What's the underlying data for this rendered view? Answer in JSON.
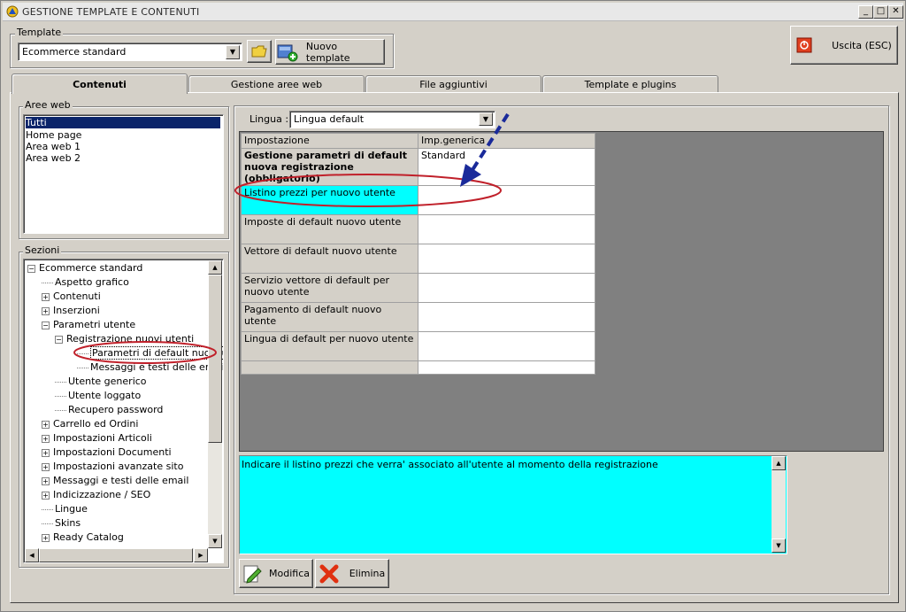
{
  "window": {
    "title": "GESTIONE TEMPLATE E CONTENUTI",
    "minimize": "_",
    "maximize": "□",
    "close": "✕"
  },
  "template": {
    "group_label": "Template",
    "selected": "Ecommerce standard",
    "new_button": "Nuovo template"
  },
  "exit_button": "Uscita (ESC)",
  "tabs": [
    {
      "label": "Contenuti",
      "active": true
    },
    {
      "label": "Gestione aree web",
      "active": false
    },
    {
      "label": "File aggiuntivi",
      "active": false
    },
    {
      "label": "Template e plugins",
      "active": false
    }
  ],
  "aree_web": {
    "label": "Aree web",
    "items": [
      "Tutti",
      "Home page",
      "Area web 1",
      "Area web 2"
    ],
    "selected_index": 0
  },
  "sezioni": {
    "label": "Sezioni",
    "tree": [
      {
        "label": "Ecommerce standard",
        "level": 0,
        "exp": "−"
      },
      {
        "label": "Aspetto grafico",
        "level": 1,
        "exp": ""
      },
      {
        "label": "Contenuti",
        "level": 1,
        "exp": "+"
      },
      {
        "label": "Inserzioni",
        "level": 1,
        "exp": "+"
      },
      {
        "label": "Parametri utente",
        "level": 1,
        "exp": "−"
      },
      {
        "label": "Registrazione nuovi utenti",
        "level": 2,
        "exp": "−"
      },
      {
        "label": "Parametri di default nuovi utent",
        "level": 3,
        "exp": "",
        "selected": true
      },
      {
        "label": "Messaggi e testi delle email",
        "level": 3,
        "exp": ""
      },
      {
        "label": "Utente generico",
        "level": 2,
        "exp": ""
      },
      {
        "label": "Utente loggato",
        "level": 2,
        "exp": ""
      },
      {
        "label": "Recupero password",
        "level": 2,
        "exp": ""
      },
      {
        "label": "Carrello ed Ordini",
        "level": 1,
        "exp": "+"
      },
      {
        "label": "Impostazioni Articoli",
        "level": 1,
        "exp": "+"
      },
      {
        "label": "Impostazioni Documenti",
        "level": 1,
        "exp": "+"
      },
      {
        "label": "Impostazioni avanzate sito",
        "level": 1,
        "exp": "+"
      },
      {
        "label": "Messaggi e testi delle email",
        "level": 1,
        "exp": "+"
      },
      {
        "label": "Indicizzazione / SEO",
        "level": 1,
        "exp": "+"
      },
      {
        "label": "Lingue",
        "level": 1,
        "exp": ""
      },
      {
        "label": "Skins",
        "level": 1,
        "exp": ""
      },
      {
        "label": "Ready Catalog",
        "level": 1,
        "exp": "+"
      }
    ]
  },
  "lingua": {
    "label": "Lingua :",
    "selected": "Lingua default"
  },
  "grid": {
    "headers": [
      "Impostazione",
      "Imp.generica"
    ],
    "rows": [
      {
        "label": "Gestione parametri di default nuova registrazione (obbligatorio)",
        "value": "Standard",
        "bold": true
      },
      {
        "label": "Listino prezzi per nuovo utente",
        "value": "",
        "highlight": true
      },
      {
        "label": "Imposte di default nuovo utente",
        "value": ""
      },
      {
        "label": "Vettore di default nuovo utente",
        "value": ""
      },
      {
        "label": "Servizio vettore di default per nuovo utente",
        "value": ""
      },
      {
        "label": "Pagamento di default nuovo utente",
        "value": ""
      },
      {
        "label": "Lingua di default per nuovo utente",
        "value": ""
      },
      {
        "label": "",
        "value": ""
      }
    ]
  },
  "description": "Indicare il listino prezzi che verra' associato all'utente al momento della registrazione",
  "buttons": {
    "modifica": "Modifica",
    "elimina": "Elimina"
  },
  "colors": {
    "highlight": "#00ffff",
    "selection": "#0a246a",
    "annotation_red": "#c0202a",
    "arrow_blue": "#1a2a9a"
  }
}
